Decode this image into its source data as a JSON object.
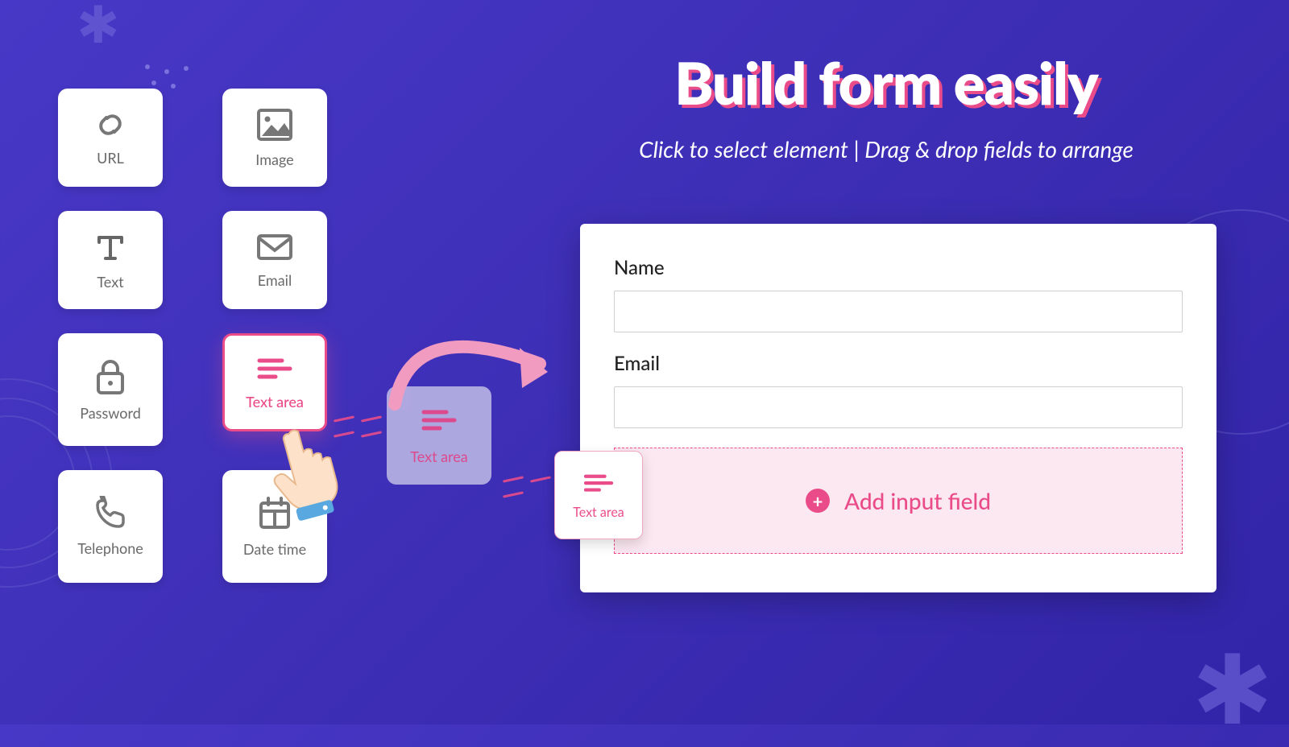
{
  "headline": {
    "title": "Build form easily",
    "subtitle": "Click to select element | Drag & drop fields to arrange"
  },
  "palette": {
    "url": "URL",
    "image": "Image",
    "text": "Text",
    "email": "Email",
    "password": "Password",
    "textarea": "Text area",
    "telephone": "Telephone",
    "datetime": "Date time"
  },
  "drag": {
    "ghost_label": "Text area",
    "drop_label": "Text area"
  },
  "form": {
    "name_label": "Name",
    "email_label": "Email",
    "add_field": "Add input field"
  },
  "colors": {
    "accent": "#ea4c89",
    "bg_start": "#4838c7",
    "bg_end": "#3224a8"
  }
}
